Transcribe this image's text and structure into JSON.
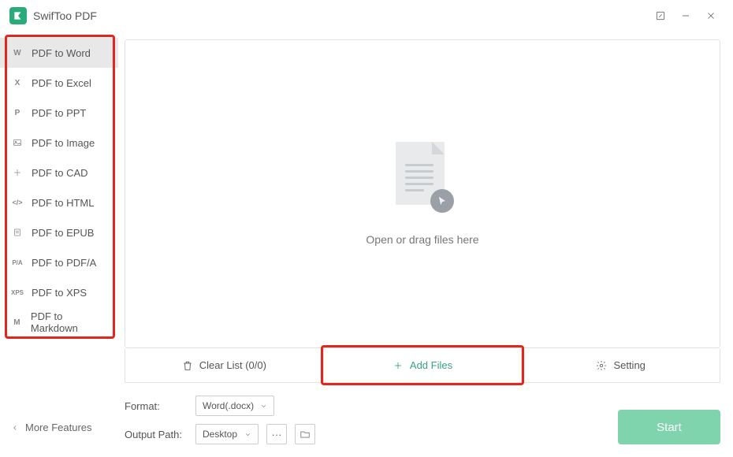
{
  "app": {
    "title": "SwifToo PDF"
  },
  "sidebar": {
    "items": [
      {
        "icon": "W",
        "label": "PDF to Word",
        "active": true
      },
      {
        "icon": "X",
        "label": "PDF to Excel"
      },
      {
        "icon": "P",
        "label": "PDF to PPT"
      },
      {
        "icon": "img",
        "label": "PDF to Image"
      },
      {
        "icon": "cad",
        "label": "PDF to CAD"
      },
      {
        "icon": "</>",
        "label": "PDF to HTML"
      },
      {
        "icon": "epub",
        "label": "PDF to EPUB"
      },
      {
        "icon": "P/A",
        "label": "PDF to PDF/A"
      },
      {
        "icon": "XPS",
        "label": "PDF to XPS"
      },
      {
        "icon": "M",
        "label": "PDF to Markdown"
      }
    ],
    "more": "More Features"
  },
  "drop": {
    "text": "Open or drag files here"
  },
  "actions": {
    "clear": "Clear List (0/0)",
    "add": "Add Files",
    "setting": "Setting"
  },
  "form": {
    "format_label": "Format:",
    "format_value": "Word(.docx)",
    "output_label": "Output Path:",
    "output_value": "Desktop",
    "more_dots": "···"
  },
  "start": {
    "label": "Start"
  },
  "highlights": {
    "sidebar": true,
    "add_files": true
  }
}
